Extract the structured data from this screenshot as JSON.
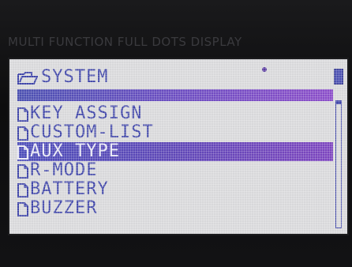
{
  "bezel": {
    "label": "MULTI FUNCTION FULL DOTS DISPLAY"
  },
  "menu": {
    "header": "SYSTEM",
    "items": [
      {
        "label": "KEY ASSIGN",
        "selected": false
      },
      {
        "label": "CUSTOM-LIST",
        "selected": false
      },
      {
        "label": "AUX TYPE",
        "selected": true
      },
      {
        "label": "R-MODE",
        "selected": false
      },
      {
        "label": "BATTERY",
        "selected": false
      },
      {
        "label": "BUZZER",
        "selected": false
      }
    ]
  },
  "colors": {
    "text": "#3f45a8",
    "selection": "#5e46b6",
    "screen": "#d8d8da"
  },
  "icons": {
    "header": "folder-icon",
    "item": "file-icon"
  }
}
